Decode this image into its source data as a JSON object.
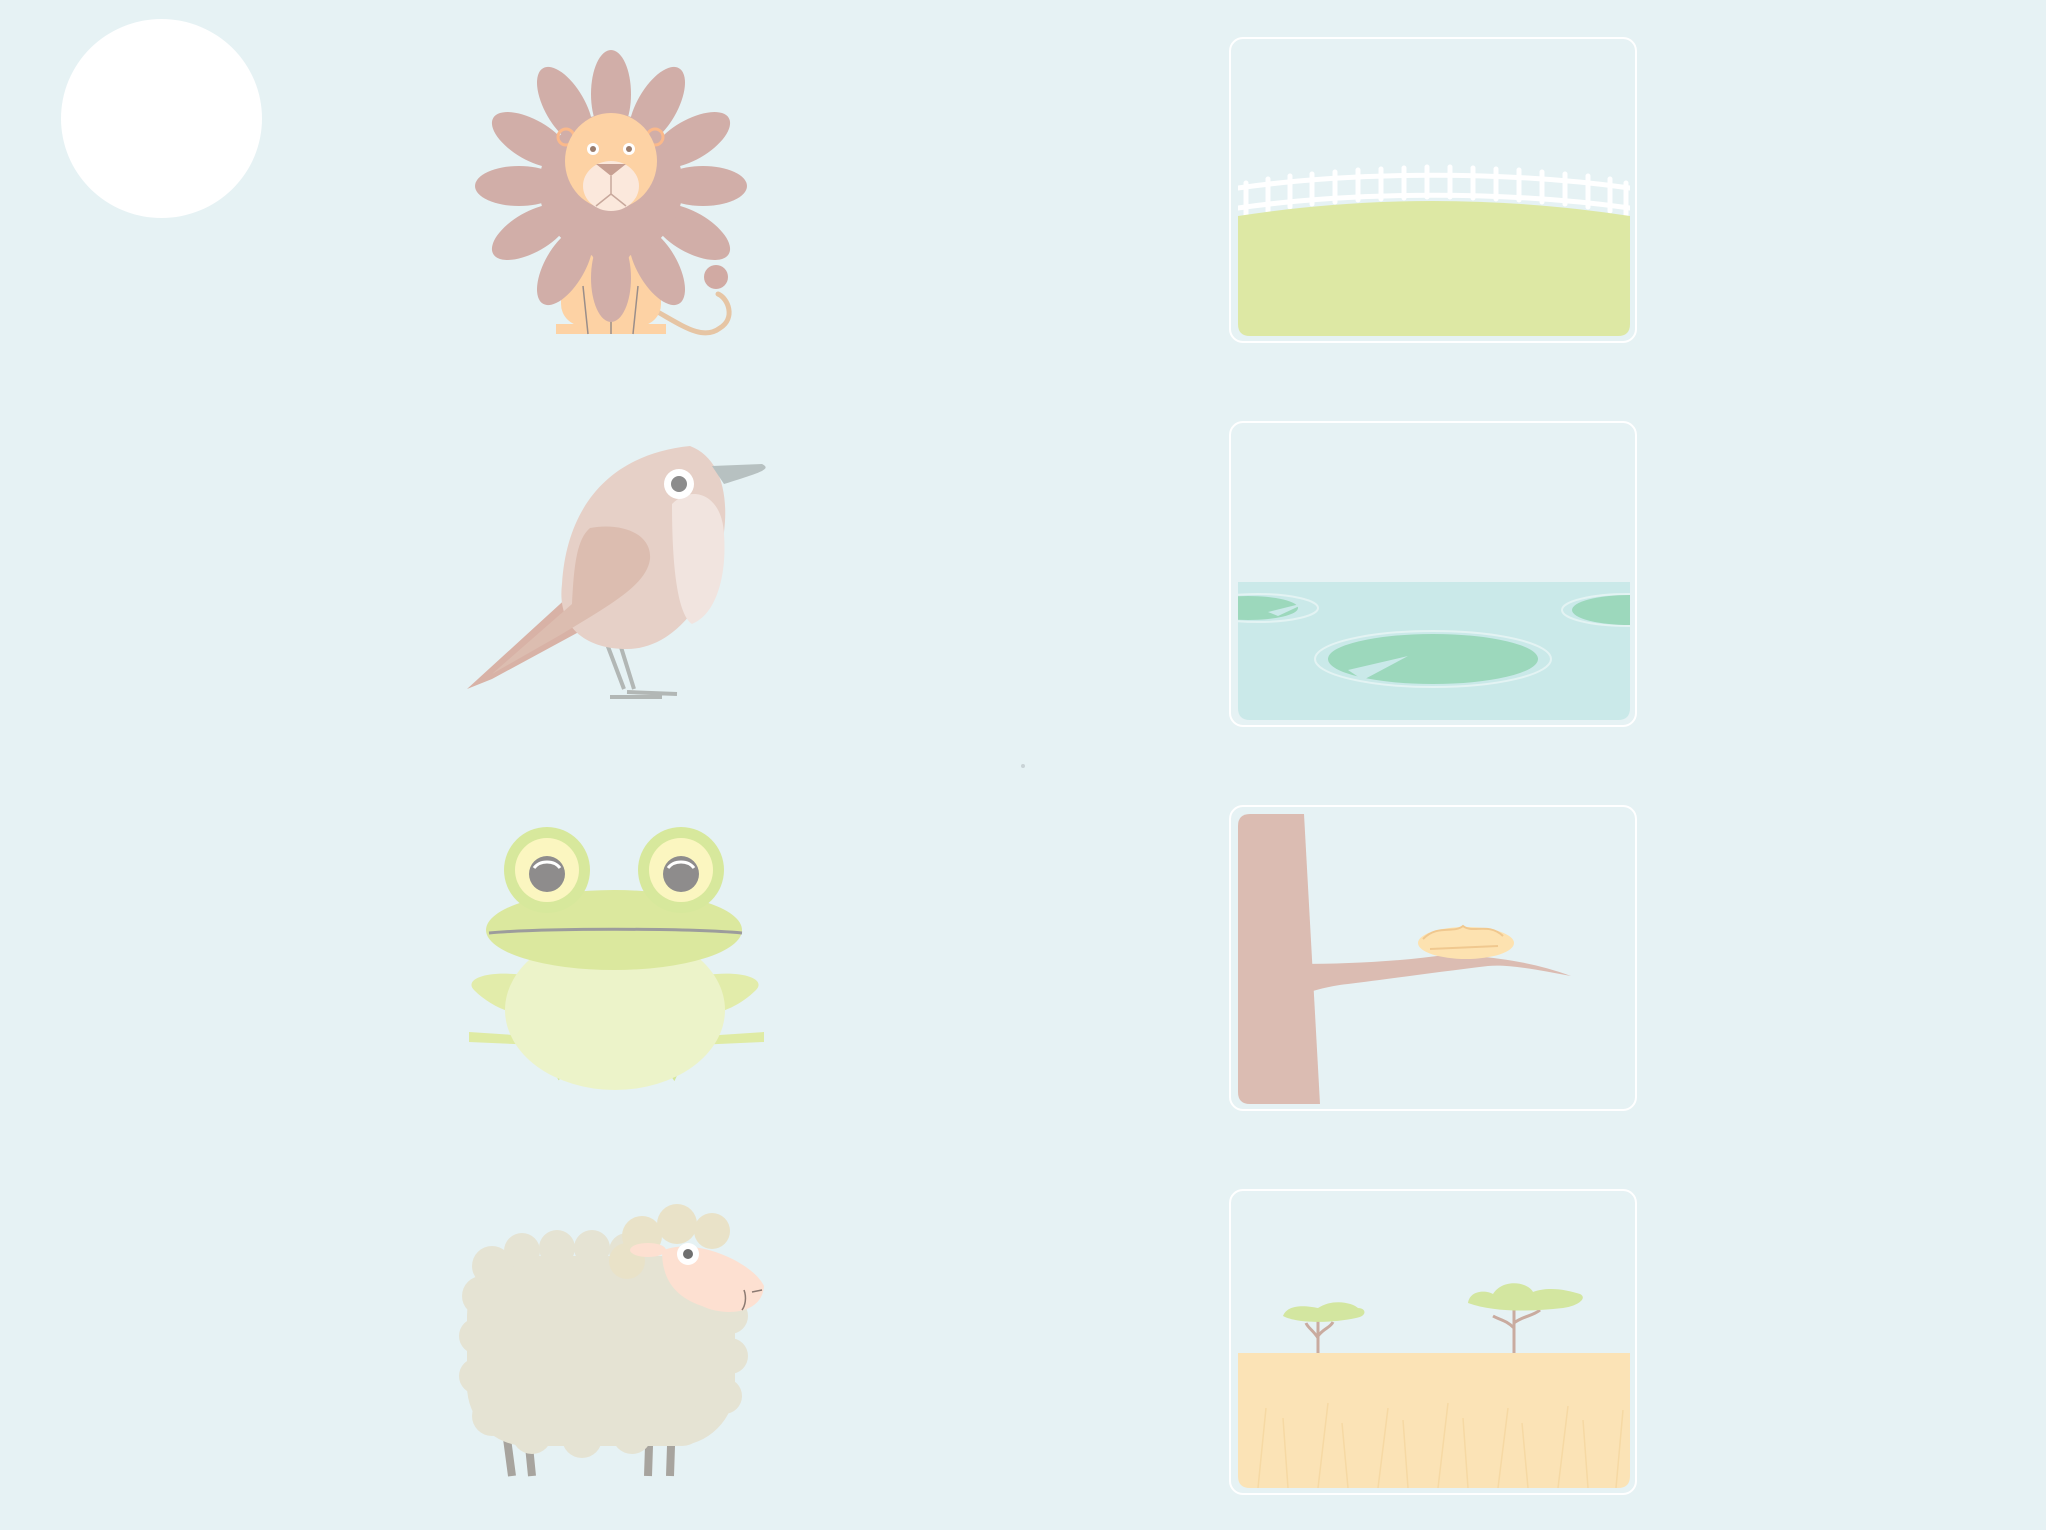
{
  "screen": {
    "background_color": "#e6f2f4",
    "home_button": {
      "icon": "home-circle-icon",
      "color": "#ffffff"
    }
  },
  "animals": [
    {
      "id": "lion",
      "icon": "lion-icon"
    },
    {
      "id": "bird",
      "icon": "bird-icon"
    },
    {
      "id": "frog",
      "icon": "frog-icon"
    },
    {
      "id": "sheep",
      "icon": "sheep-icon"
    }
  ],
  "habitats": [
    {
      "id": "farm-field",
      "icon": "field-with-fence-icon"
    },
    {
      "id": "pond",
      "icon": "pond-with-lily-pads-icon"
    },
    {
      "id": "tree-nest",
      "icon": "tree-branch-with-nest-icon"
    },
    {
      "id": "savanna",
      "icon": "savanna-with-acacia-trees-icon"
    }
  ],
  "colors": {
    "card_border": "#ffffff",
    "grass": "#dde8a4",
    "water": "#cae9e9",
    "lily_pad": "#9cd8bc",
    "tree_trunk": "#dbbcb2",
    "savanna_ground": "#fbe3b6",
    "acacia": "#d3e6a0"
  }
}
